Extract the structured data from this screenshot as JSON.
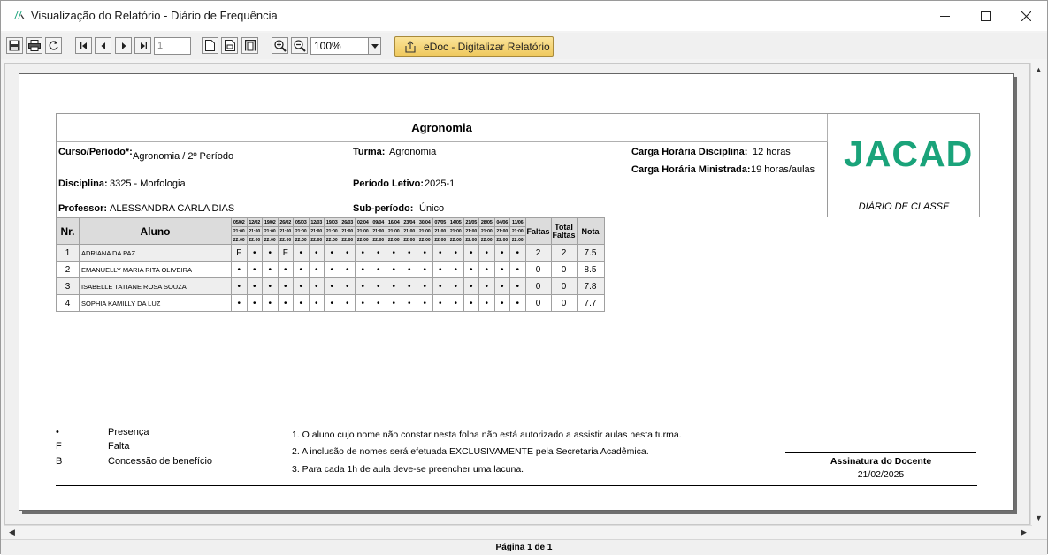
{
  "window": {
    "title": "Visualização do Relatório - Diário de Frequência",
    "minimize_icon": "minimize-icon",
    "maximize_icon": "maximize-icon",
    "close_icon": "close-icon"
  },
  "toolbar": {
    "page_number": "1",
    "zoom": "100%",
    "edoc_label": "eDoc - Digitalizar Relatório"
  },
  "report": {
    "title": "Agronomia",
    "curso_label": "Curso/Período*:",
    "curso_value": "Agronomia / 2º Período",
    "turma_label": "Turma:",
    "turma_value": "Agronomia",
    "carga_disc_label": "Carga Horária Disciplina:",
    "carga_disc_value": "12 horas",
    "carga_min_label": "Carga Horária Ministrada:",
    "carga_min_value": "19 horas/aulas",
    "disciplina_label": "Disciplina:",
    "disciplina_value": "3325 - Morfologia",
    "periodo_label": "Período Letivo:",
    "periodo_value": "2025-1",
    "professor_label": "Professor:",
    "professor_value": "ALESSANDRA CARLA DIAS",
    "subperiodo_label": "Sub-período:",
    "subperiodo_value": "Único",
    "logo_text": "JACAD",
    "diario_label": "DIÁRIO DE CLASSE"
  },
  "table": {
    "col_nr": "Nr.",
    "col_aluno": "Aluno",
    "col_faltas": "Faltas",
    "col_total_faltas_1": "Total",
    "col_total_faltas_2": "Faltas",
    "col_nota": "Nota",
    "dates": [
      "05/02",
      "12/02",
      "19/02",
      "26/02",
      "05/03",
      "12/03",
      "19/03",
      "26/03",
      "02/04",
      "09/04",
      "16/04",
      "23/04",
      "30/04",
      "07/05",
      "14/05",
      "21/05",
      "28/05",
      "04/06",
      "11/06"
    ],
    "time_start": "21:00",
    "time_end": "22:00",
    "rows": [
      {
        "nr": "1",
        "aluno": "ADRIANA DA PAZ",
        "marks": [
          "F",
          "•",
          "•",
          "F",
          "•",
          "•",
          "•",
          "•",
          "•",
          "•",
          "•",
          "•",
          "•",
          "•",
          "•",
          "•",
          "•",
          "•",
          "•"
        ],
        "faltas": "2",
        "total": "2",
        "nota": "7.5"
      },
      {
        "nr": "2",
        "aluno": "EMANUELLY MARIA RITA OLIVEIRA",
        "marks": [
          "•",
          "•",
          "•",
          "•",
          "•",
          "•",
          "•",
          "•",
          "•",
          "•",
          "•",
          "•",
          "•",
          "•",
          "•",
          "•",
          "•",
          "•",
          "•"
        ],
        "faltas": "0",
        "total": "0",
        "nota": "8.5"
      },
      {
        "nr": "3",
        "aluno": "ISABELLE TATIANE ROSA SOUZA",
        "marks": [
          "•",
          "•",
          "•",
          "•",
          "•",
          "•",
          "•",
          "•",
          "•",
          "•",
          "•",
          "•",
          "•",
          "•",
          "•",
          "•",
          "•",
          "•",
          "•"
        ],
        "faltas": "0",
        "total": "0",
        "nota": "7.8"
      },
      {
        "nr": "4",
        "aluno": "SOPHIA KAMILLY DA LUZ",
        "marks": [
          "•",
          "•",
          "•",
          "•",
          "•",
          "•",
          "•",
          "•",
          "•",
          "•",
          "•",
          "•",
          "•",
          "•",
          "•",
          "•",
          "•",
          "•",
          "•"
        ],
        "faltas": "0",
        "total": "0",
        "nota": "7.7"
      }
    ]
  },
  "legend": [
    {
      "symbol": "•",
      "text": "Presença"
    },
    {
      "symbol": "F",
      "text": "Falta"
    },
    {
      "symbol": "B",
      "text": "Concessão de benefício"
    }
  ],
  "notes": [
    "1. O aluno cujo nome não constar nesta folha não está autorizado a assistir aulas nesta turma.",
    "2. A inclusão de nomes será efetuada EXCLUSIVAMENTE pela Secretaria  Acadêmica.",
    "3. Para cada 1h de aula deve-se preencher uma lacuna."
  ],
  "signature": {
    "label": "Assinatura do Docente",
    "date": "21/02/2025"
  },
  "status": {
    "page_info": "Página 1 de 1"
  }
}
